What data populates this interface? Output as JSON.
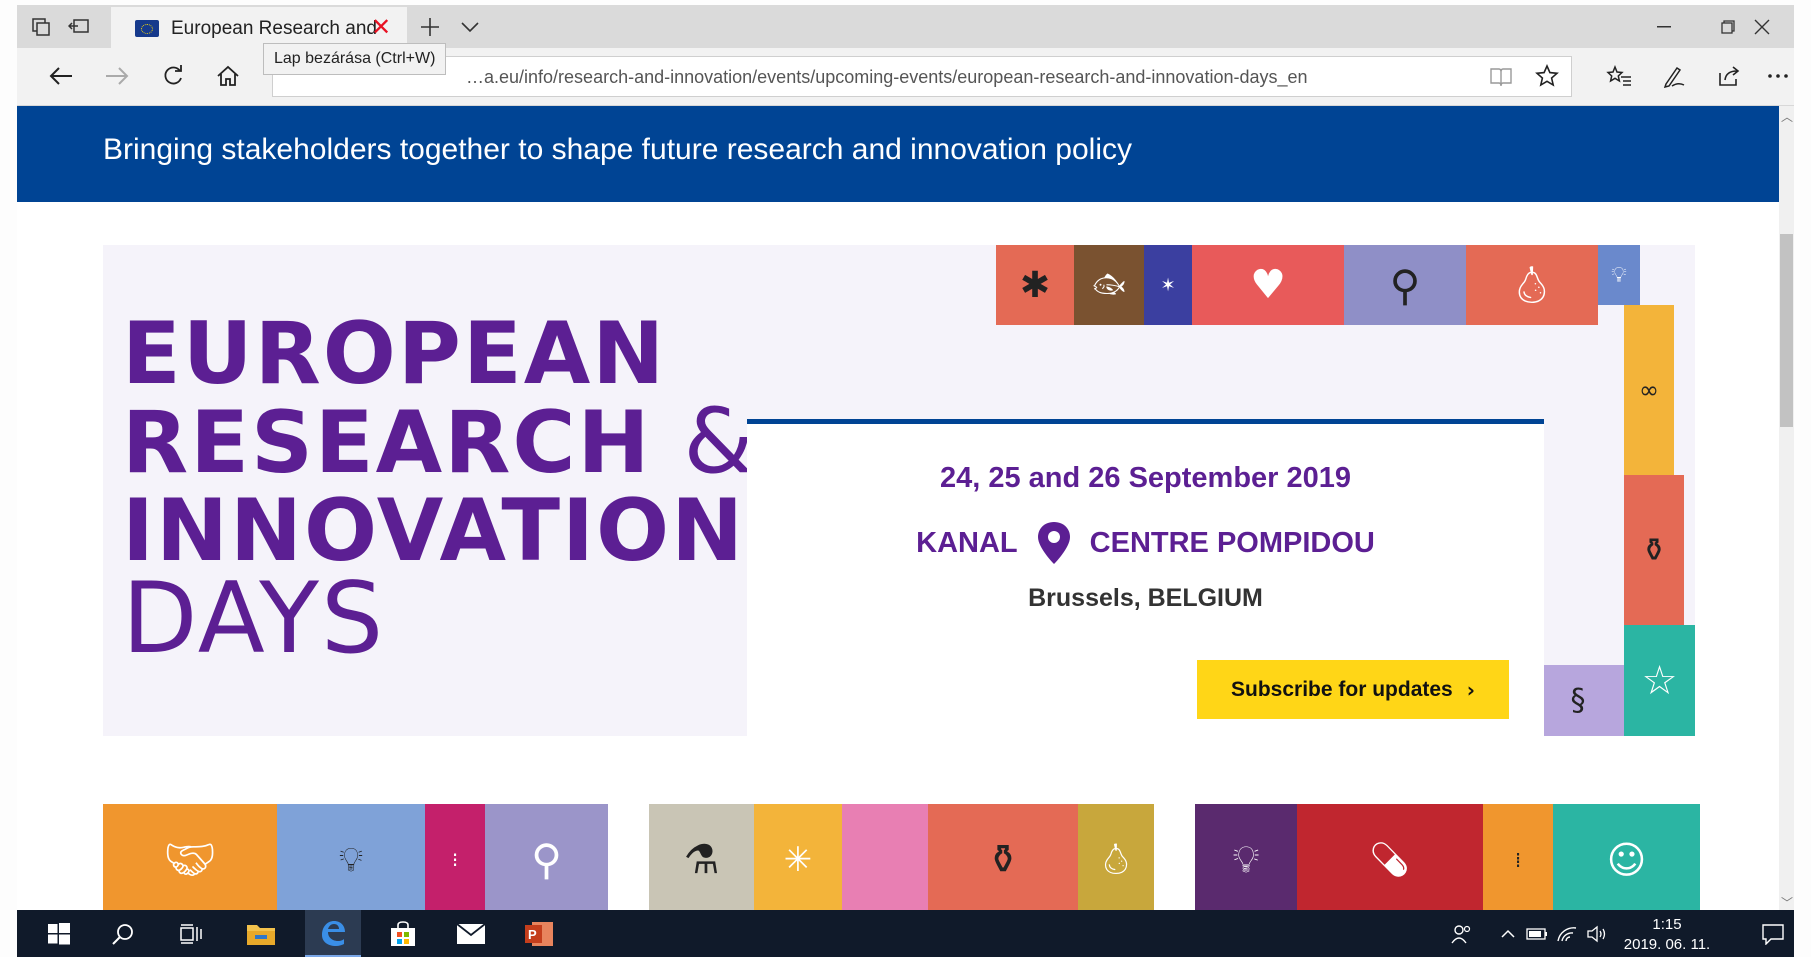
{
  "browser": {
    "tab_title": "European Research and",
    "url": "…a.eu/info/research-and-innovation/events/upcoming-events/european-research-and-innovation-days_en",
    "tooltip": "Lap bezárása (Ctrl+W)"
  },
  "page": {
    "banner_text": "Bringing stakeholders together to shape future research and innovation policy",
    "brand": {
      "line1": "EUROPEAN",
      "line2": "RESEARCH",
      "amp": "&",
      "line3": "INNOVATION",
      "line4": "DAYS"
    },
    "event": {
      "dates": "24, 25 and 26 September 2019",
      "venue_left": "KANAL",
      "venue_right": "CENTRE POMPIDOU",
      "city": "Brussels, BELGIUM",
      "subscribe_label": "Subscribe for updates",
      "subscribe_chevron": "›"
    }
  },
  "taskbar": {
    "time": "1:15",
    "date": "2019. 06. 11."
  },
  "colors": {
    "eu_blue": "#004494",
    "brand_purple": "#5c1f93",
    "cta_yellow": "#ffd617",
    "taskbar": "#101a2a"
  }
}
